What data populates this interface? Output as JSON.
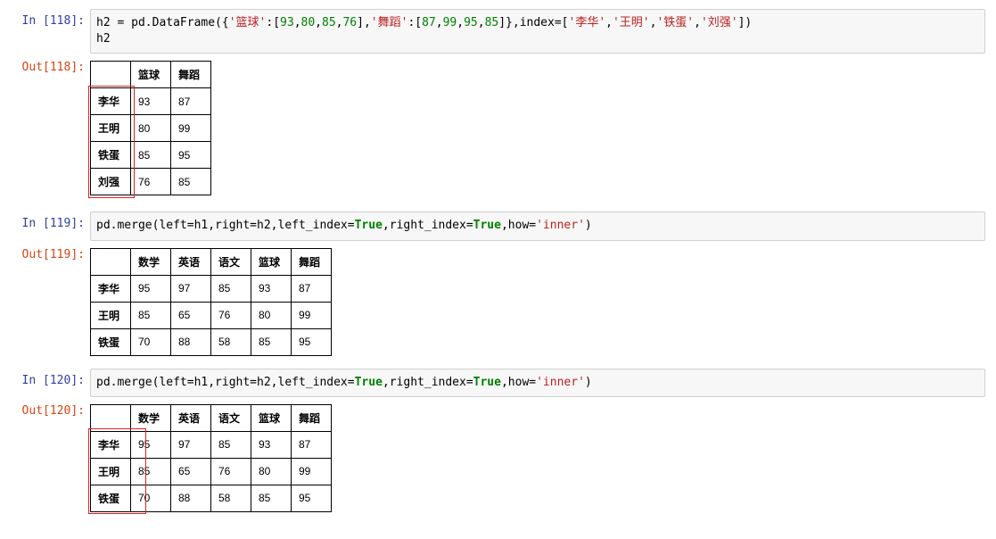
{
  "cells": {
    "c118": {
      "in_prompt": "In  [118]:",
      "out_prompt": "Out[118]:",
      "code_parts": [
        {
          "t": "h2 = pd.DataFrame({"
        },
        {
          "t": "'篮球'",
          "c": "tk-str"
        },
        {
          "t": ":["
        },
        {
          "t": "93",
          "c": "tk-num"
        },
        {
          "t": ","
        },
        {
          "t": "80",
          "c": "tk-num"
        },
        {
          "t": ","
        },
        {
          "t": "85",
          "c": "tk-num"
        },
        {
          "t": ","
        },
        {
          "t": "76",
          "c": "tk-num"
        },
        {
          "t": "],"
        },
        {
          "t": "'舞蹈'",
          "c": "tk-str"
        },
        {
          "t": ":["
        },
        {
          "t": "87",
          "c": "tk-num"
        },
        {
          "t": ","
        },
        {
          "t": "99",
          "c": "tk-num"
        },
        {
          "t": ","
        },
        {
          "t": "95",
          "c": "tk-num"
        },
        {
          "t": ","
        },
        {
          "t": "85",
          "c": "tk-num"
        },
        {
          "t": "]},index=["
        },
        {
          "t": "'李华'",
          "c": "tk-str"
        },
        {
          "t": ","
        },
        {
          "t": "'王明'",
          "c": "tk-str"
        },
        {
          "t": ","
        },
        {
          "t": "'铁蛋'",
          "c": "tk-str"
        },
        {
          "t": ","
        },
        {
          "t": "'刘强'",
          "c": "tk-str"
        },
        {
          "t": "])"
        },
        {
          "t": "\nh2"
        }
      ],
      "table": {
        "columns": [
          "",
          "篮球",
          "舞蹈"
        ],
        "rows": [
          [
            "李华",
            "93",
            "87"
          ],
          [
            "王明",
            "80",
            "99"
          ],
          [
            "铁蛋",
            "85",
            "95"
          ],
          [
            "刘强",
            "76",
            "85"
          ]
        ],
        "red_box": {
          "top_row": 1,
          "col": 0,
          "height_rows": 4
        }
      }
    },
    "c119": {
      "in_prompt": "In  [119]:",
      "out_prompt": "Out[119]:",
      "code_parts": [
        {
          "t": "pd.merge(left=h1,right=h2,left_index="
        },
        {
          "t": "True",
          "c": "tk-builtin"
        },
        {
          "t": ",right_index="
        },
        {
          "t": "True",
          "c": "tk-builtin"
        },
        {
          "t": ",how="
        },
        {
          "t": "'inner'",
          "c": "tk-str"
        },
        {
          "t": ")"
        }
      ],
      "table": {
        "columns": [
          "",
          "数学",
          "英语",
          "语文",
          "篮球",
          "舞蹈"
        ],
        "rows": [
          [
            "李华",
            "95",
            "97",
            "85",
            "93",
            "87"
          ],
          [
            "王明",
            "85",
            "65",
            "76",
            "80",
            "99"
          ],
          [
            "铁蛋",
            "70",
            "88",
            "58",
            "85",
            "95"
          ]
        ]
      }
    },
    "c120": {
      "in_prompt": "In  [120]:",
      "out_prompt": "Out[120]:",
      "code_parts": [
        {
          "t": "pd.merge(left=h1,right=h2,left_index="
        },
        {
          "t": "True",
          "c": "tk-builtin"
        },
        {
          "t": ",right_index="
        },
        {
          "t": "True",
          "c": "tk-builtin"
        },
        {
          "t": ",how="
        },
        {
          "t": "'inner'",
          "c": "tk-str"
        },
        {
          "t": ")"
        }
      ],
      "table": {
        "columns": [
          "",
          "数学",
          "英语",
          "语文",
          "篮球",
          "舞蹈"
        ],
        "rows": [
          [
            "李华",
            "95",
            "97",
            "85",
            "93",
            "87"
          ],
          [
            "王明",
            "85",
            "65",
            "76",
            "80",
            "99"
          ],
          [
            "铁蛋",
            "70",
            "88",
            "58",
            "85",
            "95"
          ]
        ],
        "red_box": {
          "top_row": 1,
          "col": 0,
          "height_rows": 3,
          "include_col1": true
        }
      }
    }
  }
}
